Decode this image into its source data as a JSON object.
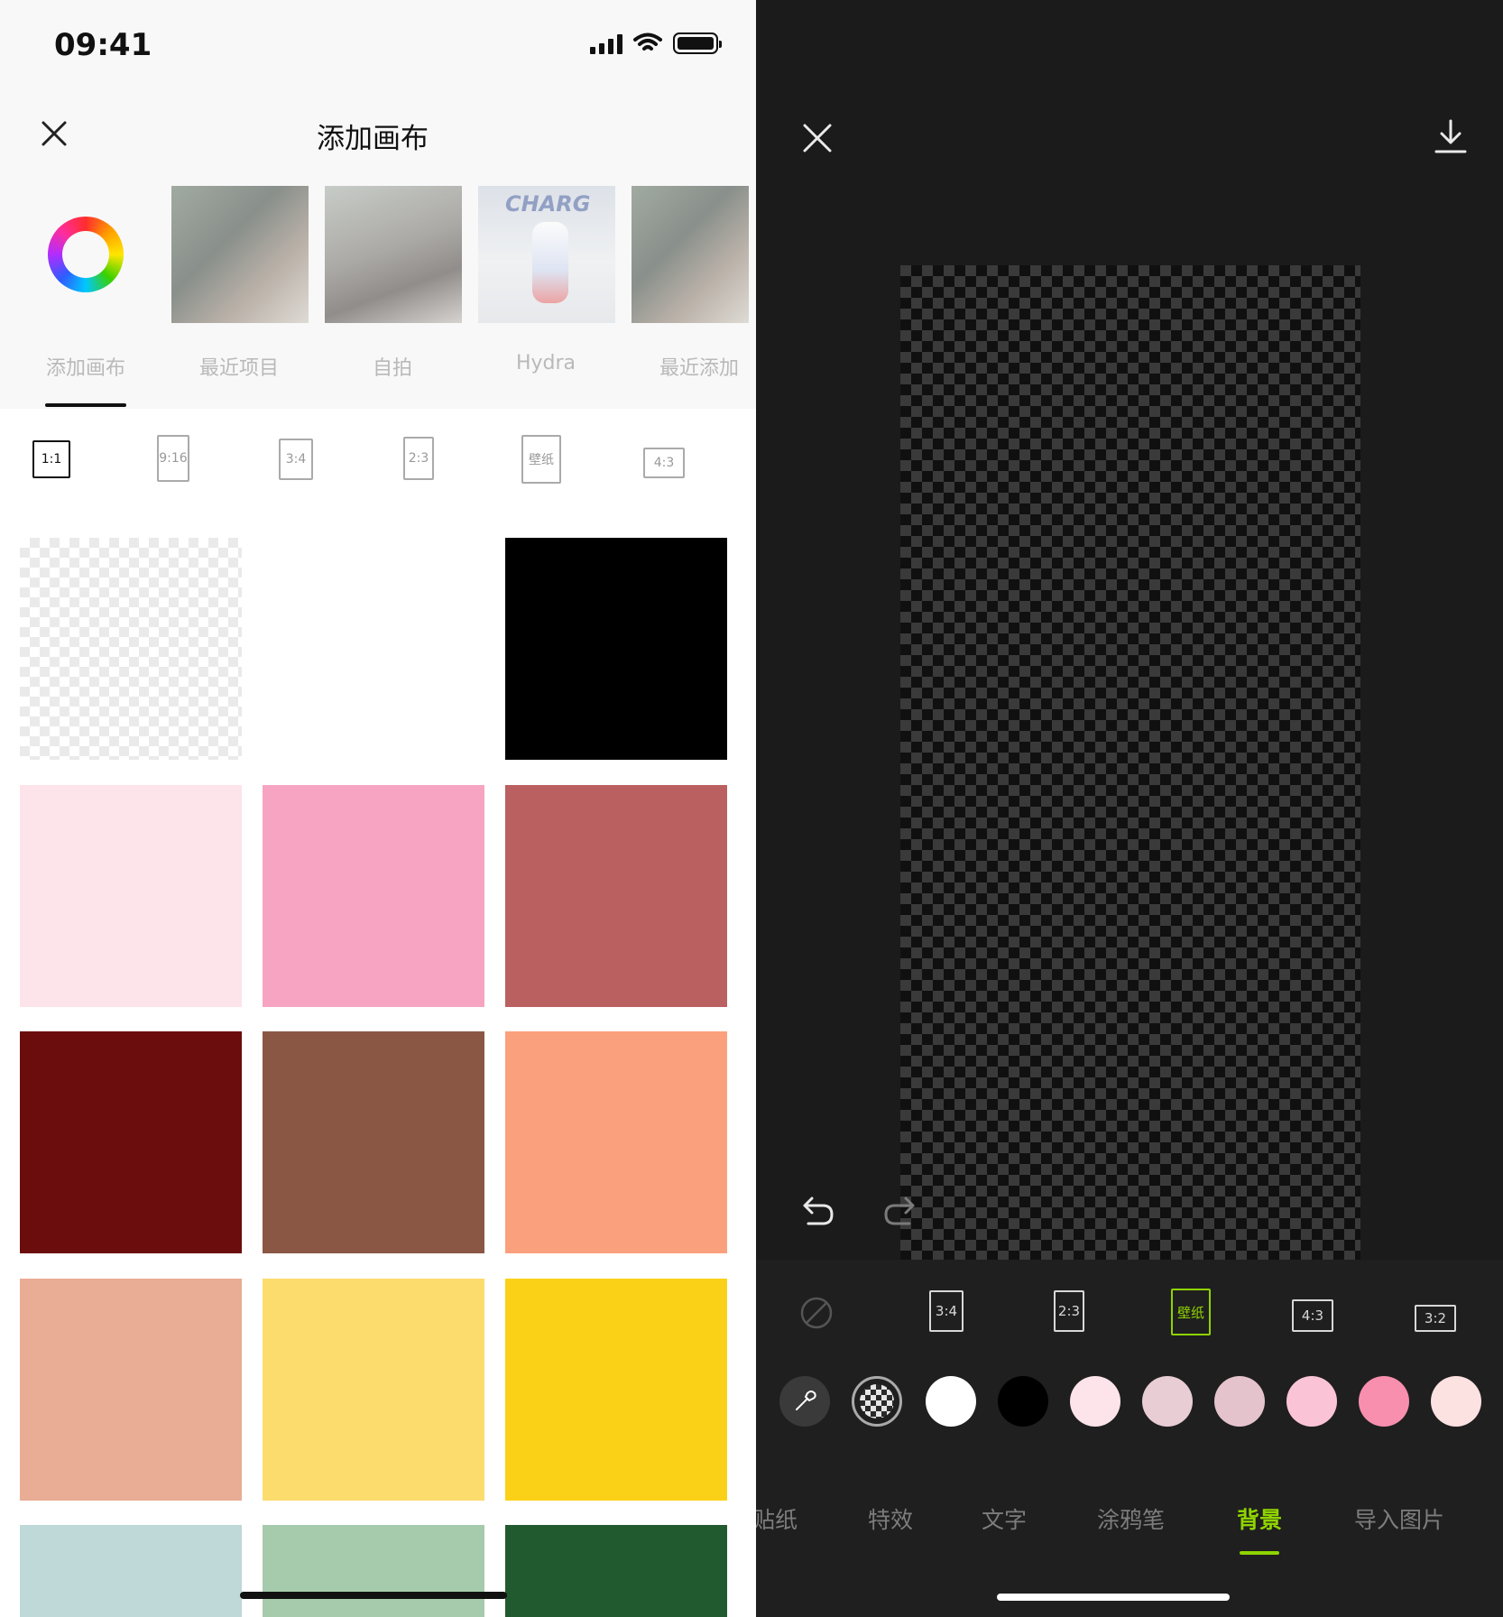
{
  "left": {
    "status_time": "09:41",
    "title": "添加画布",
    "tabs": [
      {
        "label": "添加画布",
        "active": true
      },
      {
        "label": "最近项目",
        "active": false
      },
      {
        "label": "自拍",
        "active": false
      },
      {
        "label": "Hydra",
        "active": false
      },
      {
        "label": "最近添加",
        "active": false
      }
    ],
    "ratios": [
      {
        "label": "1:1",
        "active": true
      },
      {
        "label": "9:16",
        "active": false
      },
      {
        "label": "3:4",
        "active": false
      },
      {
        "label": "2:3",
        "active": false
      },
      {
        "label": "壁纸",
        "active": false
      },
      {
        "label": "4:3",
        "active": false
      }
    ],
    "thumb_labels": [
      "CHARG"
    ],
    "swatches": [
      "transparent-checker",
      "#ffffff",
      "#000000",
      "#fde3ea",
      "#f7a4c2",
      "#bb6060",
      "#6c0d0d",
      "#8b5745",
      "#fba07d",
      "#e9ac94",
      "#fcdc6c",
      "#fbd117",
      "#bfd8d8",
      "#a6cbac",
      "#225a30"
    ]
  },
  "right": {
    "ratios": [
      {
        "label": "3:4",
        "active": false
      },
      {
        "label": "2:3",
        "active": false
      },
      {
        "label": "壁纸",
        "active": true
      },
      {
        "label": "4:3",
        "active": false
      },
      {
        "label": "3:2",
        "active": false
      }
    ],
    "color_dots": [
      "#ffffff",
      "#000000",
      "#fde4ea",
      "#e8cdd5",
      "#e5c3cd",
      "#fbc4d6",
      "#f88fae",
      "#fde2e2"
    ],
    "bottom_tabs": [
      {
        "label": "贴纸",
        "active": false
      },
      {
        "label": "特效",
        "active": false
      },
      {
        "label": "文字",
        "active": false
      },
      {
        "label": "涂鸦笔",
        "active": false
      },
      {
        "label": "背景",
        "active": true
      },
      {
        "label": "导入图片",
        "active": false
      }
    ],
    "accent_color": "#8fd400"
  }
}
